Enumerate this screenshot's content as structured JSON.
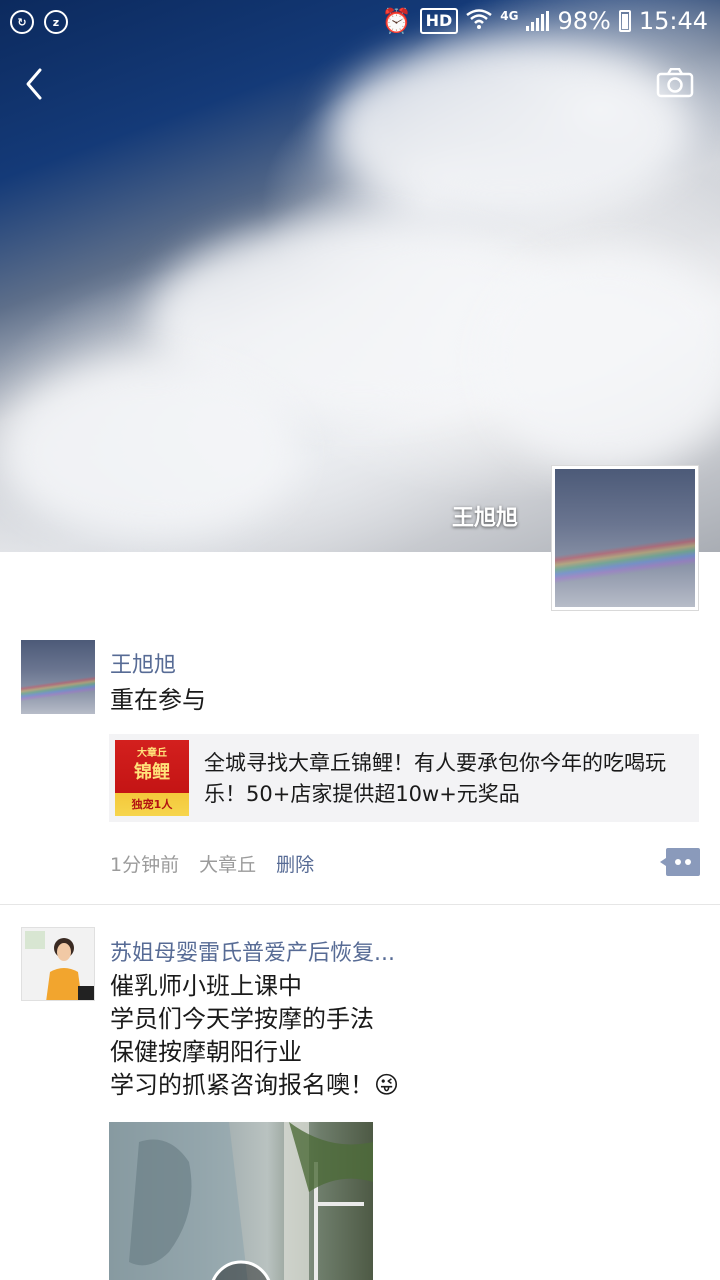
{
  "status_bar": {
    "battery": "98%",
    "time": "15:44",
    "network": "4G",
    "hd": "HD"
  },
  "cover": {
    "user_name": "王旭旭"
  },
  "posts": [
    {
      "author": "王旭旭",
      "text": "重在参与",
      "link": {
        "title": "全城寻找大章丘锦鲤！有人要承包你今年的吃喝玩乐！50+店家提供超10w+元奖品",
        "thumb_top": "大章丘",
        "thumb_main": "锦鲤",
        "thumb_bottom": "独宠1人"
      },
      "time": "1分钟前",
      "location": "大章丘",
      "delete_label": "删除"
    },
    {
      "author": "苏姐母婴雷氏普爱产后恢复...",
      "text": "催乳师小班上课中\n学员们今天学按摩的手法\n保健按摩朝阳行业\n学习的抓紧咨询报名噢！😜"
    }
  ]
}
